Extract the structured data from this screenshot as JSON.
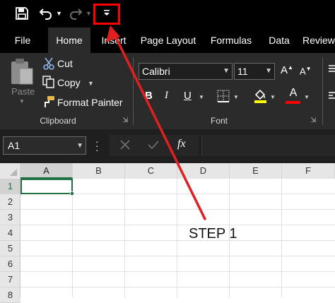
{
  "quick_access": {
    "save_icon": "save-icon",
    "undo_icon": "undo-icon",
    "redo_icon": "redo-icon",
    "customize_icon": "customize-quick-access-icon",
    "highlight_color": "#ff0000"
  },
  "tabs": [
    "File",
    "Home",
    "Insert",
    "Page Layout",
    "Formulas",
    "Data",
    "Review"
  ],
  "active_tab": "Home",
  "clipboard": {
    "paste_label": "Paste",
    "cut_label": "Cut",
    "copy_label": "Copy",
    "format_painter_label": "Format Painter",
    "group_label": "Clipboard"
  },
  "font": {
    "font_name": "Calibri",
    "font_size": "11",
    "bold": "B",
    "italic": "I",
    "underline": "U",
    "font_color_glyph": "A",
    "group_label": "Font",
    "highlight_color": "#ffff00",
    "font_color": "#ff0000"
  },
  "formula_bar": {
    "name_box": "A1",
    "fx_label": "fx",
    "value": ""
  },
  "grid": {
    "columns": [
      "A",
      "B",
      "C",
      "D",
      "E",
      "F"
    ],
    "rows": [
      "1",
      "2",
      "3",
      "4",
      "5",
      "6",
      "7",
      "8"
    ],
    "selected_cell": "A1",
    "accent_color": "#217346"
  },
  "annotation": {
    "label": "STEP 1",
    "color": "#e02020"
  }
}
